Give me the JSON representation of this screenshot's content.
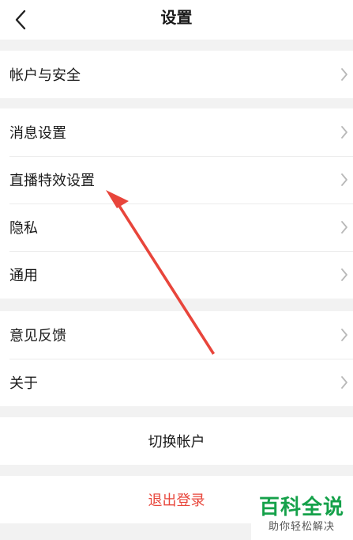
{
  "nav": {
    "title": "设置"
  },
  "groups": [
    [
      "帐户与安全"
    ],
    [
      "消息设置",
      "直播特效设置",
      "隐私",
      "通用"
    ],
    [
      "意见反馈",
      "关于"
    ]
  ],
  "switch_account_label": "切换帐户",
  "logout_label": "退出登录",
  "watermark": {
    "title": "百科全说",
    "subtitle": "助你轻松解决"
  },
  "colors": {
    "logout": "#e8473c",
    "annotation_arrow": "#e8453b",
    "watermark_brand": "#15a14a",
    "page_bg": "#f2f2f2"
  }
}
